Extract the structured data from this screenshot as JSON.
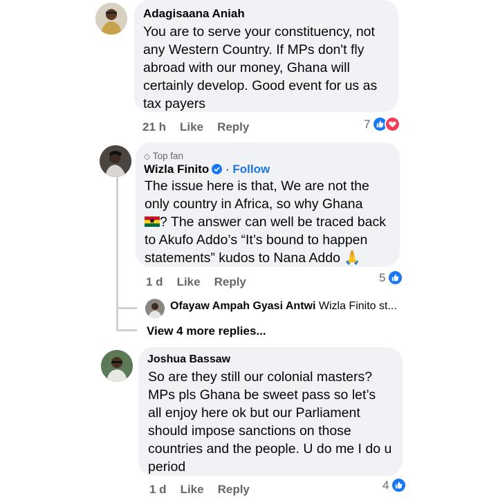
{
  "comments": [
    {
      "author": "Adagisaana Aniah",
      "text": "You are to serve your constituency, not\nany Western Country. If MPs don't fly\nabroad with our money, Ghana will\ncertainly develop. Good event for us as\ntax payers",
      "time": "21 h",
      "like": "Like",
      "reply": "Reply",
      "reactions": "7"
    },
    {
      "badge": "Top fan",
      "author": "Wizla Finito",
      "follow": "Follow",
      "text_part1": "The issue here is that, We are not the\nonly country in Africa, so why Ghana\n",
      "text_part2": "? The answer can well be traced back\nto Akufo Addo’s “It’s bound to happen\nstatements” kudos to Nana Addo ",
      "emoji_end": "🙏",
      "time": "1 d",
      "like": "Like",
      "reply": "Reply",
      "reactions": "5",
      "reply_preview": {
        "author": "Ofayaw Ampah Gyasi Antwi",
        "text": "Wizla Finito st..."
      },
      "view_more": "View 4 more replies..."
    },
    {
      "author": "Joshua Bassaw",
      "text": "So are they still our colonial masters?\nMPs pls Ghana be sweet pass so let’s\nall enjoy here ok but our Parliament\nshould impose sanctions on those\ncountries and the people. U do me I do u\nperiod",
      "time": "1 d",
      "like": "Like",
      "reply": "Reply",
      "reactions": "4"
    }
  ],
  "icons": {
    "like_reaction": "thumbs-up-icon",
    "love_reaction": "heart-icon",
    "top_fan": "diamond-icon",
    "verified": "check-badge-icon"
  },
  "colors": {
    "bubble": "#f0f2f5",
    "meta": "#65676b",
    "link": "#1b74e4",
    "like_blue": "#1877f2",
    "love_red": "#f33e58"
  }
}
